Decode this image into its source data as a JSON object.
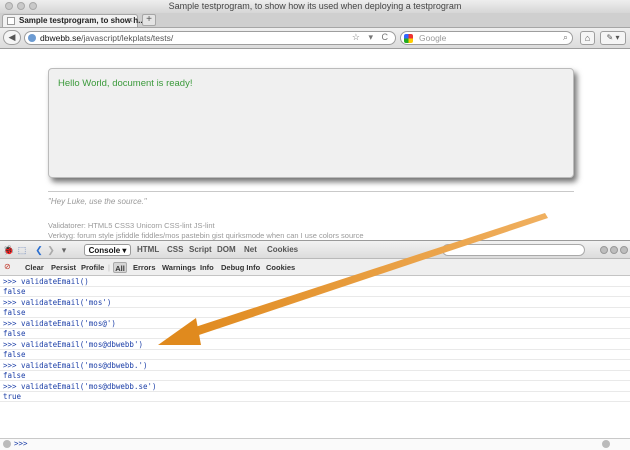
{
  "window": {
    "title": "Sample testprogram, to show how its used when deploying a testprogram"
  },
  "tabs": [
    {
      "title": "Sample testprogram, to show h...",
      "close": "×"
    }
  ],
  "new_tab": "+",
  "navbar": {
    "back": "◀",
    "url_host": "dbwebb.se",
    "url_path": "/javascript/lekplats/tests/",
    "url_icons": "☆ ▾ C",
    "search_placeholder": "Google",
    "search_icon": "⌕",
    "home": "⌂",
    "tools": "✎ ▾"
  },
  "page": {
    "ready_message": "Hello World, document is ready!",
    "quote": "\"Hey Luke, use the source.\"",
    "validators": "Validatorer: HTML5 CSS3 Unicorn CSS-lint JS-lint",
    "tools": "Verktyg: forum style jsfiddle fiddles/mos pastebin gist quirksmode when can I use colors source"
  },
  "firebug": {
    "icons": {
      "bug": "🐞",
      "inspect": "⬚",
      "back": "❮",
      "forward": "❯",
      "separator": "▾"
    },
    "panel_tabs": {
      "console": "Console ▾",
      "html": "HTML",
      "css": "CSS",
      "script": "Script",
      "dom": "DOM",
      "net": "Net",
      "cookies": "Cookies"
    },
    "search_icon": "⌕",
    "console_toolbar": {
      "clear_icon": "⊘",
      "clear": "Clear",
      "persist": "Persist",
      "profile": "Profile",
      "separator": "|",
      "all": "All",
      "errors": "Errors",
      "warnings": "Warnings",
      "info": "Info",
      "debug_info": "Debug Info",
      "cookies": "Cookies"
    },
    "console_lines": [
      {
        "type": "cmd",
        "text": ">>> validateEmail()"
      },
      {
        "type": "res",
        "text": "false"
      },
      {
        "type": "cmd",
        "text": ">>> validateEmail('mos')"
      },
      {
        "type": "res",
        "text": "false"
      },
      {
        "type": "cmd",
        "text": ">>> validateEmail('mos@')"
      },
      {
        "type": "res",
        "text": "false"
      },
      {
        "type": "cmd",
        "text": ">>> validateEmail('mos@dbwebb')"
      },
      {
        "type": "res",
        "text": "false"
      },
      {
        "type": "cmd",
        "text": ">>> validateEmail('mos@dbwebb.')"
      },
      {
        "type": "res",
        "text": "false"
      },
      {
        "type": "cmd",
        "text": ">>> validateEmail('mos@dbwebb.se')"
      },
      {
        "type": "res",
        "text": "true"
      }
    ],
    "command_prompt": ">>>"
  },
  "colors": {
    "ready_text": "#3b9a3b",
    "console_text": "#1c3fa8",
    "arrow": "#e8962a"
  }
}
